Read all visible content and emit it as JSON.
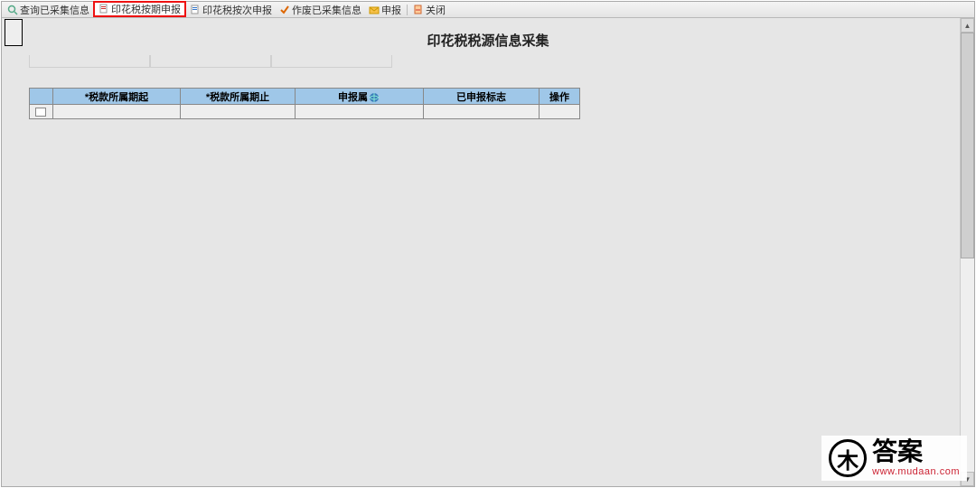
{
  "toolbar": {
    "items": [
      {
        "label": "查询已采集信息",
        "icon": "search-icon"
      },
      {
        "label": "印花税按期申报",
        "icon": "doc-red-icon",
        "highlight": true
      },
      {
        "label": "印花税按次申报",
        "icon": "doc-blue-icon"
      },
      {
        "label": "作废已采集信息",
        "icon": "delete-icon"
      },
      {
        "label": "申报",
        "icon": "mail-icon"
      },
      {
        "label": "关闭",
        "icon": "close-icon"
      }
    ]
  },
  "title": "印花税税源信息采集",
  "table": {
    "headers": {
      "col1": "*税款所属期起",
      "col2": "*税款所属期止",
      "col3": "申报属",
      "col4": "已申报标志",
      "col5": "操作"
    },
    "rows": [
      {
        "col1": "",
        "col2": "",
        "col3": "",
        "col4": "",
        "col5": ""
      }
    ]
  },
  "watermark": {
    "badge": "木",
    "text": "答案",
    "url": "www.mudaan.com"
  }
}
